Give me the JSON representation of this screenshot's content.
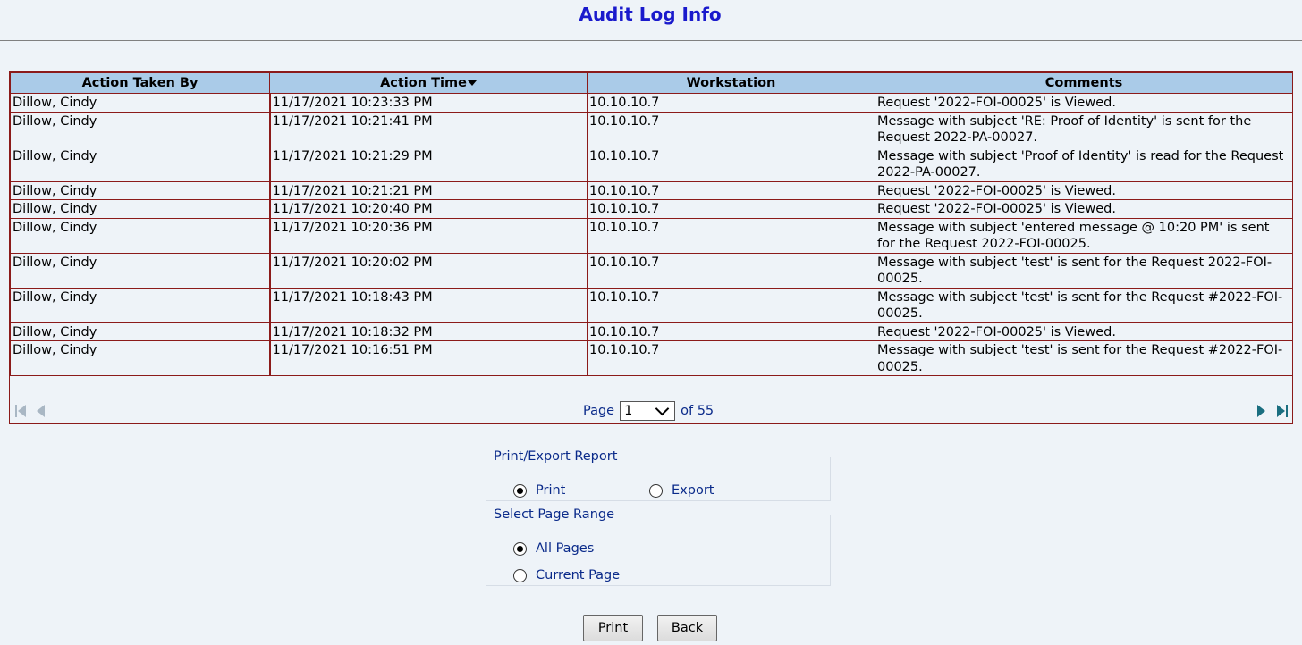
{
  "page": {
    "title": "Audit Log Info"
  },
  "grid": {
    "columns": [
      "Action Taken By",
      "Action Time",
      "Workstation",
      "Comments"
    ],
    "sorted_column": "Action Time",
    "sort_direction": "descending",
    "rows": [
      {
        "by": "Dillow, Cindy",
        "time": "11/17/2021 10:23:33 PM",
        "workstation": "10.10.10.7",
        "comments": "Request '2022-FOI-00025' is Viewed."
      },
      {
        "by": "Dillow, Cindy",
        "time": "11/17/2021 10:21:41 PM",
        "workstation": "10.10.10.7",
        "comments": "Message with subject 'RE: Proof of Identity' is sent for the Request 2022-PA-00027."
      },
      {
        "by": "Dillow, Cindy",
        "time": "11/17/2021 10:21:29 PM",
        "workstation": "10.10.10.7",
        "comments": "Message with subject 'Proof of Identity' is read for the Request 2022-PA-00027."
      },
      {
        "by": "Dillow, Cindy",
        "time": "11/17/2021 10:21:21 PM",
        "workstation": "10.10.10.7",
        "comments": "Request '2022-FOI-00025' is Viewed."
      },
      {
        "by": "Dillow, Cindy",
        "time": "11/17/2021 10:20:40 PM",
        "workstation": "10.10.10.7",
        "comments": "Request '2022-FOI-00025' is Viewed."
      },
      {
        "by": "Dillow, Cindy",
        "time": "11/17/2021 10:20:36 PM",
        "workstation": "10.10.10.7",
        "comments": "Message with subject 'entered message @ 10:20 PM' is sent for the Request 2022-FOI-00025."
      },
      {
        "by": "Dillow, Cindy",
        "time": "11/17/2021 10:20:02 PM",
        "workstation": "10.10.10.7",
        "comments": "Message with subject 'test' is sent for the Request 2022-FOI-00025."
      },
      {
        "by": "Dillow, Cindy",
        "time": "11/17/2021 10:18:43 PM",
        "workstation": "10.10.10.7",
        "comments": "Message with subject 'test' is sent for the Request #2022-FOI-00025."
      },
      {
        "by": "Dillow, Cindy",
        "time": "11/17/2021 10:18:32 PM",
        "workstation": "10.10.10.7",
        "comments": "Request '2022-FOI-00025' is Viewed."
      },
      {
        "by": "Dillow, Cindy",
        "time": "11/17/2021 10:16:51 PM",
        "workstation": "10.10.10.7",
        "comments": "Message with subject 'test' is sent for the Request #2022-FOI-00025."
      }
    ]
  },
  "pager": {
    "page_label": "Page",
    "current_page": "1",
    "of_label": "of 55",
    "first_icon": "first-page-icon",
    "prev_icon": "previous-page-icon",
    "next_icon": "next-page-icon",
    "last_icon": "last-page-icon"
  },
  "print_export": {
    "legend": "Print/Export Report",
    "options": [
      {
        "label": "Print",
        "checked": true
      },
      {
        "label": "Export",
        "checked": false
      }
    ]
  },
  "page_range": {
    "legend": "Select Page Range",
    "options": [
      {
        "label": "All Pages",
        "checked": true
      },
      {
        "label": "Current Page",
        "checked": false
      }
    ]
  },
  "buttons": {
    "print": "Print",
    "back": "Back"
  },
  "colors": {
    "title": "#1a1acc",
    "header_bg": "#aacbe8",
    "grid_border": "#8b1a1a",
    "page_bg": "#eef3f8",
    "link_text": "#0a2a8a"
  }
}
